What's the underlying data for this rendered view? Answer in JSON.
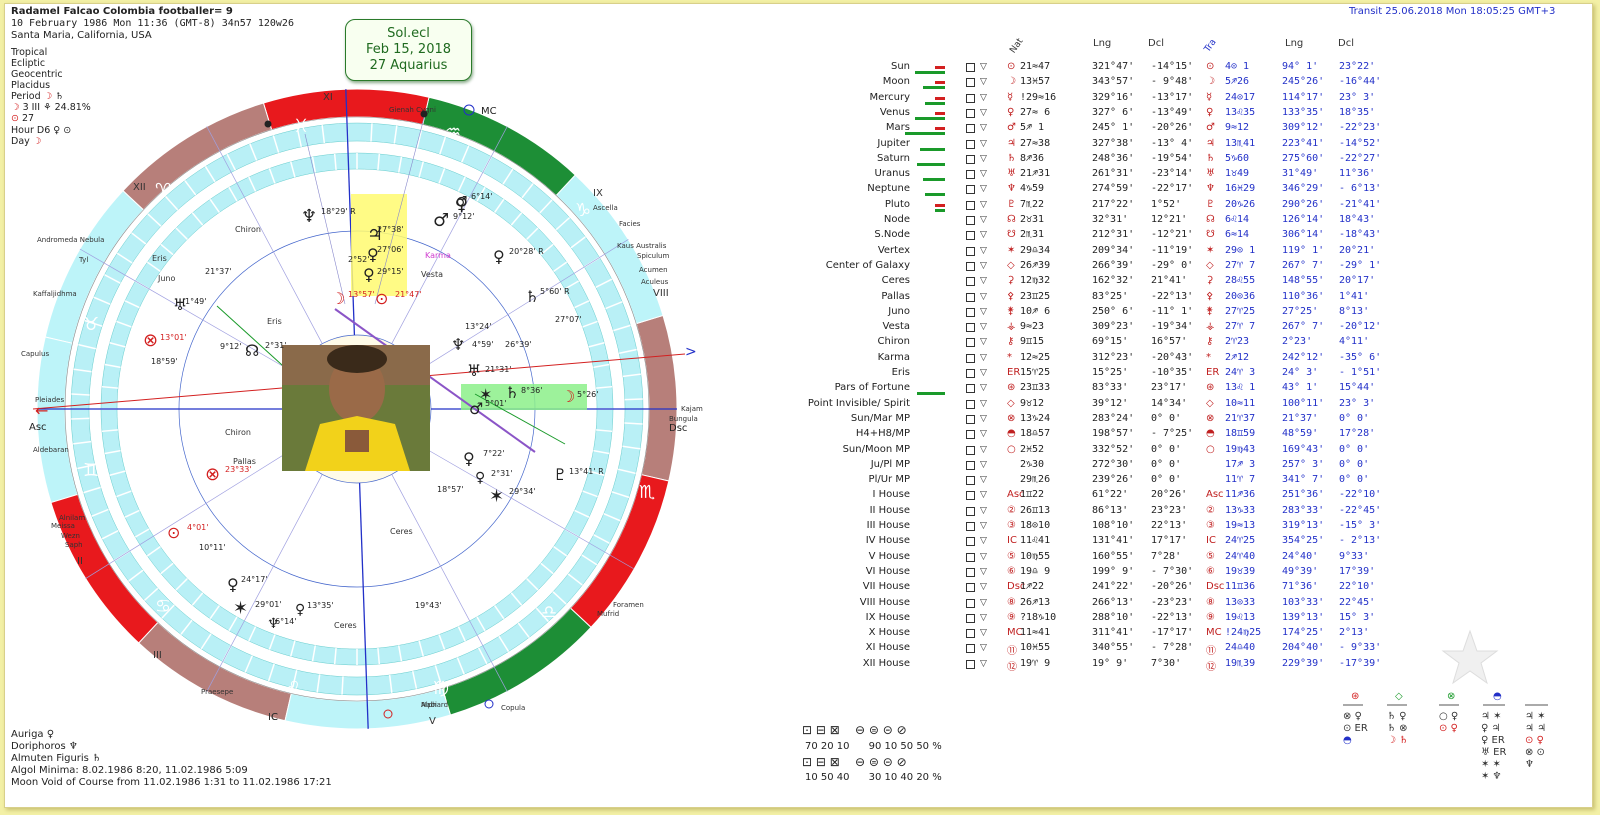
{
  "header": {
    "title": "Radamel Falcao Colombia footballer= 9",
    "datetime": "10 February 1986  Mon  11:36 (GMT-8) 34n57  120w26",
    "place": "Santa Maria, California, USA",
    "transit": "Transit 25.06.2018  Mon 18:05:25 GMT+3"
  },
  "chart_settings": {
    "items": [
      "Tropical",
      "Ecliptic",
      "Geocentric",
      "Placidus"
    ],
    "period": "Period",
    "moon_phase": "3 III",
    "moon_phase_pct": "24.81%",
    "sun_day": "27",
    "hour": "Hour D6",
    "day": "Day"
  },
  "callout": {
    "line1": "Sol.ecl",
    "line2": "Feb 15, 2018",
    "line3": "27 Aquarius"
  },
  "wheel": {
    "houses": [
      "I",
      "II",
      "III",
      "IV",
      "V",
      "VI",
      "VII",
      "VIII",
      "IX",
      "X",
      "XI",
      "XII"
    ],
    "house_labels_visible": [
      "XI",
      "XII",
      "IX",
      "VIII",
      "II",
      "III",
      "IC",
      "V"
    ],
    "angles": {
      "asc": "Asc",
      "dsc": "Dsc",
      "mc": "MC",
      "ic": "IC"
    },
    "stars": [
      "Gienah Cygni",
      "Ascella",
      "Facies",
      "Kaus Australis",
      "Spiculum",
      "Acumen",
      "Aculeus",
      "Andromeda Nebula",
      "Tyl",
      "Kaffaljidhma",
      "Capulus",
      "Pleiades",
      "Aldebaran",
      "Alnilam",
      "Meissa",
      "Wezn",
      "Saph",
      "Kajam",
      "Bungula",
      "Foramen",
      "Mufrid",
      "Alphard",
      "Copula",
      "Praesepe",
      "Nabi"
    ],
    "natal_labels": [
      "18°29' R",
      "27°38'",
      "27°06'",
      "29°15'",
      "2°52'",
      "13°57'",
      "21°47'",
      "6°14'",
      "9°12'",
      "20°28' R",
      "5°60' R",
      "27°07'",
      "21°37'",
      "1°49'",
      "13°01'",
      "18°59'",
      "9°12'",
      "2°31'",
      "13°24'",
      "4°59'",
      "26°39'",
      "21°31'",
      "8°36'",
      "5°26'",
      "5°01'",
      "7°22'",
      "2°31'",
      "13°41' R",
      "29°34'",
      "18°57'",
      "23°33'",
      "4°01'",
      "10°11'",
      "24°17'",
      "29°01'",
      "13°35'",
      "6°14'",
      "19°43'"
    ],
    "names": [
      "Chiron",
      "Eris",
      "Juno",
      "Vesta",
      "Karma",
      "Pallas",
      "Ceres"
    ]
  },
  "table": {
    "head_nat": "Nat",
    "head_tra": "Tra",
    "head_lng": "Lng",
    "head_dcl": "Dcl",
    "rows": [
      {
        "label": "Sun",
        "nval": "21≈47",
        "nlng": "321°47'",
        "ndcl": "-14°15'",
        "tval": "4⊙ 1",
        "tlng": "94° 1'",
        "tdcl": "23°22'",
        "g": 30,
        "r": 10
      },
      {
        "label": "Moon",
        "nval": "13♓57",
        "nlng": "343°57'",
        "ndcl": "- 9°48'",
        "tval": "5♐26",
        "tlng": "245°26'",
        "tdcl": "-16°44'",
        "g": 22,
        "r": 10
      },
      {
        "label": "Mercury",
        "nval": "!29≈16",
        "nlng": "329°16'",
        "ndcl": "-13°17'",
        "tval": "24⊙17",
        "tlng": "114°17'",
        "tdcl": "23° 3'",
        "g": 20,
        "r": 10
      },
      {
        "label": "Venus",
        "nval": "27≈ 6",
        "nlng": "327° 6'",
        "ndcl": "-13°49'",
        "tval": "13♌35",
        "tlng": "133°35'",
        "tdcl": "18°35'",
        "g": 30,
        "r": 10
      },
      {
        "label": "Mars",
        "nval": "5♐ 1",
        "nlng": "245° 1'",
        "ndcl": "-20°26'",
        "tval": "9≈12",
        "tlng": "309°12'",
        "tdcl": "-22°23'",
        "g": 40,
        "r": 10
      },
      {
        "label": "Jupiter",
        "nval": "27≈38",
        "nlng": "327°38'",
        "ndcl": "-13° 4'",
        "tval": "13♏41",
        "tlng": "223°41'",
        "tdcl": "-14°52'",
        "g": 25,
        "r": 0
      },
      {
        "label": "Saturn",
        "nval": "8♐36",
        "nlng": "248°36'",
        "ndcl": "-19°54'",
        "tval": "5♑60",
        "tlng": "275°60'",
        "tdcl": "-22°27'",
        "g": 28,
        "r": 0
      },
      {
        "label": "Uranus",
        "nval": "21♐31",
        "nlng": "261°31'",
        "ndcl": "-23°14'",
        "tval": "1♉49",
        "tlng": "31°49'",
        "tdcl": "11°36'",
        "g": 22,
        "r": 0
      },
      {
        "label": "Neptune",
        "nval": "4♑59",
        "nlng": "274°59'",
        "ndcl": "-22°17'",
        "tval": "16♓29",
        "tlng": "346°29'",
        "tdcl": "- 6°13'",
        "g": 20,
        "r": 0
      },
      {
        "label": "Pluto",
        "nval": "7♏22",
        "nlng": "217°22'",
        "ndcl": "1°52'",
        "tval": "20♑26",
        "tlng": "290°26'",
        "tdcl": "-21°41'",
        "g": 10,
        "r": 10
      },
      {
        "label": "Node",
        "nval": "2♉31",
        "nlng": "32°31'",
        "ndcl": "12°21'",
        "tval": "6♌14",
        "tlng": "126°14'",
        "tdcl": "18°43'",
        "g": 0,
        "r": 0
      },
      {
        "label": "S.Node",
        "nval": "2♏31",
        "nlng": "212°31'",
        "ndcl": "-12°21'",
        "tval": "6≈14",
        "tlng": "306°14'",
        "tdcl": "-18°43'",
        "g": 0,
        "r": 0
      },
      {
        "label": "Vertex",
        "nval": "29♎34",
        "nlng": "209°34'",
        "ndcl": "-11°19'",
        "tval": "29⊙ 1",
        "tlng": "119° 1'",
        "tdcl": "20°21'",
        "g": 0,
        "r": 0
      },
      {
        "label": "Center of Galaxy",
        "nval": "26♐39",
        "nlng": "266°39'",
        "ndcl": "-29° 0'",
        "tval": "27♈ 7",
        "tlng": "267° 7'",
        "tdcl": "-29° 1'",
        "g": 0,
        "r": 0
      },
      {
        "label": "Ceres",
        "nval": "12♍32",
        "nlng": "162°32'",
        "ndcl": "21°41'",
        "tval": "28♌55",
        "tlng": "148°55'",
        "tdcl": "20°17'",
        "g": 0,
        "r": 0
      },
      {
        "label": "Pallas",
        "nval": "23♊25",
        "nlng": "83°25'",
        "ndcl": "-22°13'",
        "tval": "20⊙36",
        "tlng": "110°36'",
        "tdcl": "1°41'",
        "g": 0,
        "r": 0
      },
      {
        "label": "Juno",
        "nval": "10♐ 6",
        "nlng": "250° 6'",
        "ndcl": "-11° 1'",
        "tval": "27♈25",
        "tlng": "27°25'",
        "tdcl": "8°13'",
        "g": 0,
        "r": 0
      },
      {
        "label": "Vesta",
        "nval": "9≈23",
        "nlng": "309°23'",
        "ndcl": "-19°34'",
        "tval": "27♈ 7",
        "tlng": "267° 7'",
        "tdcl": "-20°12'",
        "g": 0,
        "r": 0
      },
      {
        "label": "Chiron",
        "nval": "9♊15",
        "nlng": "69°15'",
        "ndcl": "16°57'",
        "tval": "2♈23",
        "tlng": "2°23'",
        "tdcl": "4°11'",
        "g": 0,
        "r": 0
      },
      {
        "label": "Karma",
        "nval": "12≈25",
        "nlng": "312°23'",
        "ndcl": "-20°43'",
        "tval": "2♐12",
        "tlng": "242°12'",
        "tdcl": "-35° 6'",
        "g": 0,
        "r": 0
      },
      {
        "label": "Eris",
        "nval": "15♈25",
        "nlng": "15°25'",
        "ndcl": "-10°35'",
        "tval": "24♈ 3",
        "tlng": "24° 3'",
        "tdcl": "- 1°51'",
        "g": 0,
        "r": 0
      },
      {
        "label": "Pars of Fortune",
        "nval": "23♊33",
        "nlng": "83°33'",
        "ndcl": "23°17'",
        "tval": "13♌ 1",
        "tlng": "43° 1'",
        "tdcl": "15°44'",
        "g": 28,
        "r": 0
      },
      {
        "label": "Point Invisible/ Spirit",
        "nval": "9♉12",
        "nlng": "39°12'",
        "ndcl": "14°34'",
        "tval": "10≈11",
        "tlng": "100°11'",
        "tdcl": "23° 3'",
        "g": 0,
        "r": 0
      },
      {
        "label": "Sun/Mar MP",
        "nval": "13♑24",
        "nlng": "283°24'",
        "ndcl": "0° 0'",
        "tval": "21♈37",
        "tlng": "21°37'",
        "tdcl": "0° 0'",
        "g": 0,
        "r": 0
      },
      {
        "label": "H4+H8/MP",
        "nval": "18♎57",
        "nlng": "198°57'",
        "ndcl": "- 7°25'",
        "tval": "18♊59",
        "tlng": "48°59'",
        "tdcl": "17°28'",
        "g": 0,
        "r": 0
      },
      {
        "label": "Sun/Moon MP",
        "nval": "2♓52",
        "nlng": "332°52'",
        "ndcl": "0° 0'",
        "tval": "19♍43",
        "tlng": "169°43'",
        "tdcl": "0° 0'",
        "g": 0,
        "r": 0
      },
      {
        "label": "Ju/Pl MP",
        "nval": "2♑30",
        "nlng": "272°30'",
        "ndcl": "0° 0'",
        "tval": "17♐ 3",
        "tlng": "257° 3'",
        "tdcl": "0° 0'",
        "g": 0,
        "r": 0
      },
      {
        "label": "Pl/Ur MP",
        "nval": "29♏26",
        "nlng": "239°26'",
        "ndcl": "0° 0'",
        "tval": "11♈ 7",
        "tlng": "341° 7'",
        "tdcl": "0° 0'",
        "g": 0,
        "r": 0
      },
      {
        "label": "I House",
        "nval": "1♊22",
        "nlng": "61°22'",
        "ndcl": "20°26'",
        "tval": "11♐36",
        "tlng": "251°36'",
        "tdcl": "-22°10'",
        "g": 0,
        "r": 0
      },
      {
        "label": "II House",
        "nval": "26♊13",
        "nlng": "86°13'",
        "ndcl": "23°23'",
        "tval": "13♑33",
        "tlng": "283°33'",
        "tdcl": "-22°45'",
        "g": 0,
        "r": 0
      },
      {
        "label": "III House",
        "nval": "18⊙10",
        "nlng": "108°10'",
        "ndcl": "22°13'",
        "tval": "19≈13",
        "tlng": "319°13'",
        "tdcl": "-15° 3'",
        "g": 0,
        "r": 0
      },
      {
        "label": "IV House",
        "nval": "11♌41",
        "nlng": "131°41'",
        "ndcl": "17°17'",
        "tval": "24♈25",
        "tlng": "354°25'",
        "tdcl": "- 2°13'",
        "g": 0,
        "r": 0
      },
      {
        "label": "V House",
        "nval": "10♍55",
        "nlng": "160°55'",
        "ndcl": "7°28'",
        "tval": "24♈40",
        "tlng": "24°40'",
        "tdcl": "9°33'",
        "g": 0,
        "r": 0
      },
      {
        "label": "VI House",
        "nval": "19♎ 9",
        "nlng": "199° 9'",
        "ndcl": "- 7°30'",
        "tval": "19♉39",
        "tlng": "49°39'",
        "tdcl": "17°39'",
        "g": 0,
        "r": 0
      },
      {
        "label": "VII House",
        "nval": "1♐22",
        "nlng": "241°22'",
        "ndcl": "-20°26'",
        "tval": "11♊36",
        "tlng": "71°36'",
        "tdcl": "22°10'",
        "g": 0,
        "r": 0
      },
      {
        "label": "VIII House",
        "nval": "26♐13",
        "nlng": "266°13'",
        "ndcl": "-23°23'",
        "tval": "13⊙33",
        "tlng": "103°33'",
        "tdcl": "22°45'",
        "g": 0,
        "r": 0
      },
      {
        "label": "IX House",
        "nval": "?18♑10",
        "nlng": "288°10'",
        "ndcl": "-22°13'",
        "tval": "19♌13",
        "tlng": "139°13'",
        "tdcl": "15° 3'",
        "g": 0,
        "r": 0
      },
      {
        "label": "X House",
        "nval": "11≈41",
        "nlng": "311°41'",
        "ndcl": "-17°17'",
        "tval": "!24♍25",
        "tlng": "174°25'",
        "tdcl": "2°13'",
        "g": 0,
        "r": 0
      },
      {
        "label": "XI House",
        "nval": "10♓55",
        "nlng": "340°55'",
        "ndcl": "- 7°28'",
        "tval": "24♎40",
        "tlng": "204°40'",
        "tdcl": "- 9°33'",
        "g": 0,
        "r": 0
      },
      {
        "label": "XII House",
        "nval": "19♈ 9",
        "nlng": "19° 9'",
        "ndcl": "7°30'",
        "tval": "19♏39",
        "tlng": "229°39'",
        "tdcl": "-17°39'",
        "g": 0,
        "r": 0
      }
    ]
  },
  "bottom_left": {
    "lines": [
      "Auriga",
      "Doriphoros",
      "Almuten Figuris",
      "Algol Minima: 8.02.1986  8:20, 11.02.1986  5:09",
      "Moon Void of Course from 11.02.1986  1:31 to 11.02.1986 17:21"
    ]
  },
  "element_stats": {
    "row1": "70  20  10",
    "row2": "90  10  50  50 %",
    "row3": "10  50  40",
    "row4": "30  10  40  20 %"
  },
  "colors": {
    "accent": "#2230c8",
    "green": "#1a9a2a",
    "red": "#d32020",
    "cyan": "#b9f0f6",
    "sign_red": "#e8191d",
    "sign_green": "#1d8e36",
    "sign_brown": "#b77f7a",
    "sign_cyan": "#bdf4f9",
    "highlight_yellow": "#fffa70",
    "highlight_green": "#8cf08a",
    "aspect_purple": "#8b55c7"
  }
}
